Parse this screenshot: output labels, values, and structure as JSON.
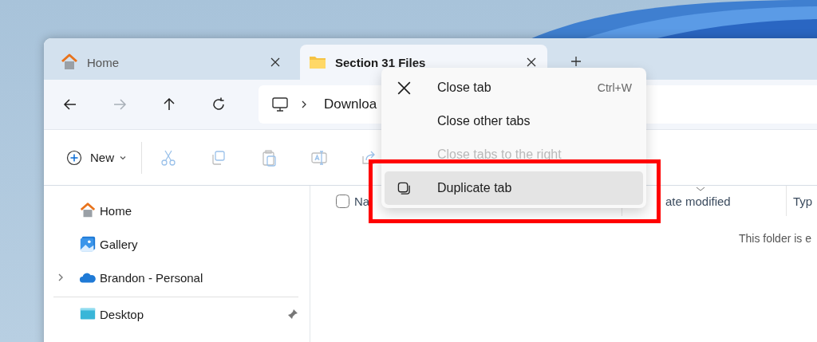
{
  "tabs": [
    {
      "label": "Home",
      "kind": "home",
      "selected": false
    },
    {
      "label": "Section 31 Files",
      "kind": "folder",
      "selected": true
    }
  ],
  "nav_buttons": [
    {
      "kind": "back",
      "disabled": false
    },
    {
      "kind": "forward",
      "disabled": true
    },
    {
      "kind": "up",
      "disabled": false
    },
    {
      "kind": "refresh",
      "disabled": false
    }
  ],
  "address": {
    "path": "Downloa"
  },
  "command_bar": {
    "new_label": "New",
    "tools": [
      {
        "kind": "cut",
        "disabled": true
      },
      {
        "kind": "copy",
        "disabled": true
      },
      {
        "kind": "paste",
        "disabled": true
      },
      {
        "kind": "rename",
        "disabled": true
      },
      {
        "kind": "share",
        "disabled": true
      }
    ]
  },
  "sidebar": {
    "groups": [
      [
        {
          "label": "Home",
          "kind": "home",
          "expandable": false
        },
        {
          "label": "Gallery",
          "kind": "gallery",
          "expandable": false
        },
        {
          "label": "Brandon - Personal",
          "kind": "cloud",
          "expandable": true
        }
      ],
      [
        {
          "label": "Desktop",
          "kind": "desktop",
          "expandable": false,
          "pinned": true
        }
      ]
    ]
  },
  "select_all": {
    "checked": false
  },
  "columns": [
    {
      "label": "Na"
    },
    {
      "label": "ate modified"
    },
    {
      "label": "Typ"
    }
  ],
  "empty_message": "This folder is e",
  "context_menu": {
    "items": [
      {
        "label": "Close tab",
        "kind": "close",
        "shortcut": "Ctrl+W",
        "disabled": false,
        "selected": false
      },
      {
        "label": "Close other tabs",
        "kind": "plain",
        "disabled": false,
        "selected": false
      },
      {
        "label": "Close tabs to the right",
        "kind": "plain",
        "disabled": true,
        "selected": false
      },
      {
        "label": "Duplicate tab",
        "kind": "duplicate",
        "disabled": false,
        "selected": true
      }
    ]
  }
}
